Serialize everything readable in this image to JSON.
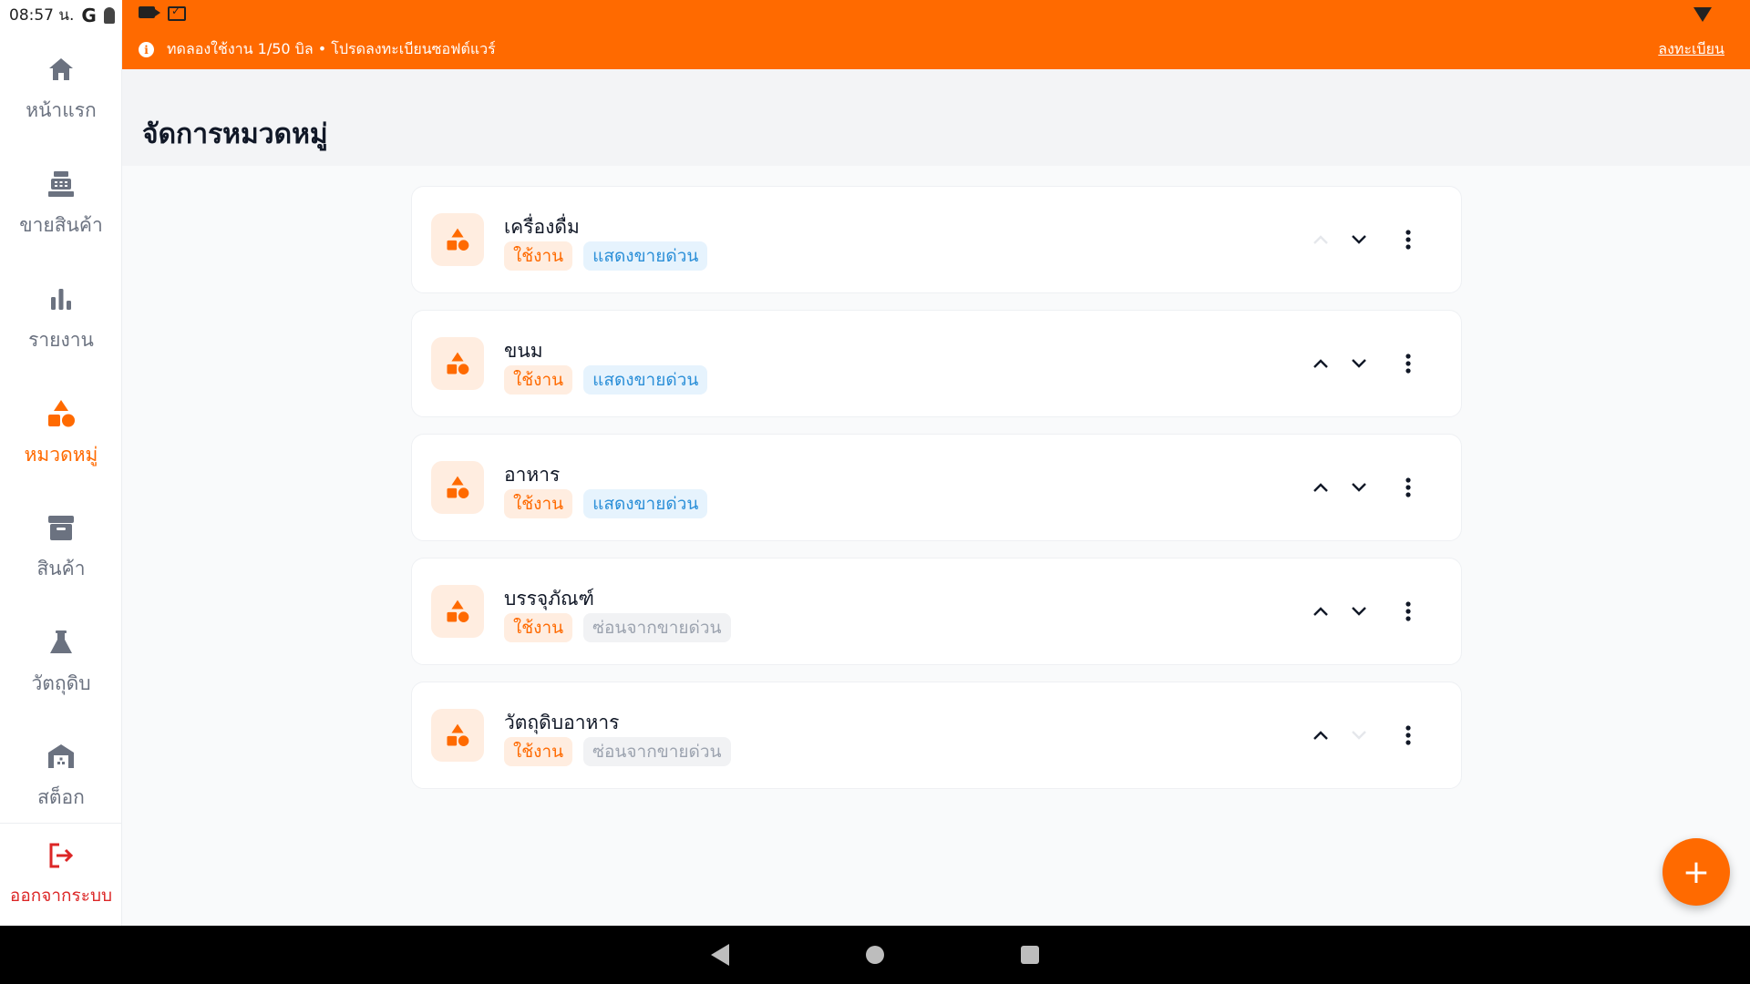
{
  "status_bar": {
    "time": "08:57 น.",
    "g_label": "G"
  },
  "banner": {
    "text": "ทดลองใช้งาน 1/50 บิล • โปรดลงทะเบียนซอฟต์แวร์",
    "register_link": "ลงทะเบียน",
    "info_glyph": "i"
  },
  "sidebar": {
    "items": [
      {
        "label": "หน้าแรก",
        "icon": "home-icon"
      },
      {
        "label": "ขายสินค้า",
        "icon": "cash-register-icon"
      },
      {
        "label": "รายงาน",
        "icon": "bar-chart-icon"
      },
      {
        "label": "หมวดหมู่",
        "icon": "category-shapes-icon",
        "active": true
      },
      {
        "label": "สินค้า",
        "icon": "archive-box-icon"
      },
      {
        "label": "วัตถุดิบ",
        "icon": "flask-icon"
      },
      {
        "label": "สต็อก",
        "icon": "warehouse-icon"
      }
    ],
    "logout_label": "ออกจากระบบ"
  },
  "page": {
    "title": "จัดการหมวดหมู่"
  },
  "categories": [
    {
      "name": "เครื่องดื่ม",
      "status": "ใช้งาน",
      "visibility": "แสดงขายด่วน",
      "visibility_state": "show",
      "up_enabled": false,
      "down_enabled": true
    },
    {
      "name": "ขนม",
      "status": "ใช้งาน",
      "visibility": "แสดงขายด่วน",
      "visibility_state": "show",
      "up_enabled": true,
      "down_enabled": true
    },
    {
      "name": "อาหาร",
      "status": "ใช้งาน",
      "visibility": "แสดงขายด่วน",
      "visibility_state": "show",
      "up_enabled": true,
      "down_enabled": true
    },
    {
      "name": "บรรจุภัณฑ์",
      "status": "ใช้งาน",
      "visibility": "ซ่อนจากขายด่วน",
      "visibility_state": "hide",
      "up_enabled": true,
      "down_enabled": true
    },
    {
      "name": "วัตถุดิบอาหาร",
      "status": "ใช้งาน",
      "visibility": "ซ่อนจากขายด่วน",
      "visibility_state": "hide",
      "up_enabled": true,
      "down_enabled": false
    }
  ],
  "fab": {
    "label": "+"
  },
  "colors": {
    "accent": "#ff6a00",
    "accent_light": "#ffede0",
    "info_blue": "#2b8fd8",
    "danger": "#dc2626",
    "muted": "#6b7280"
  }
}
